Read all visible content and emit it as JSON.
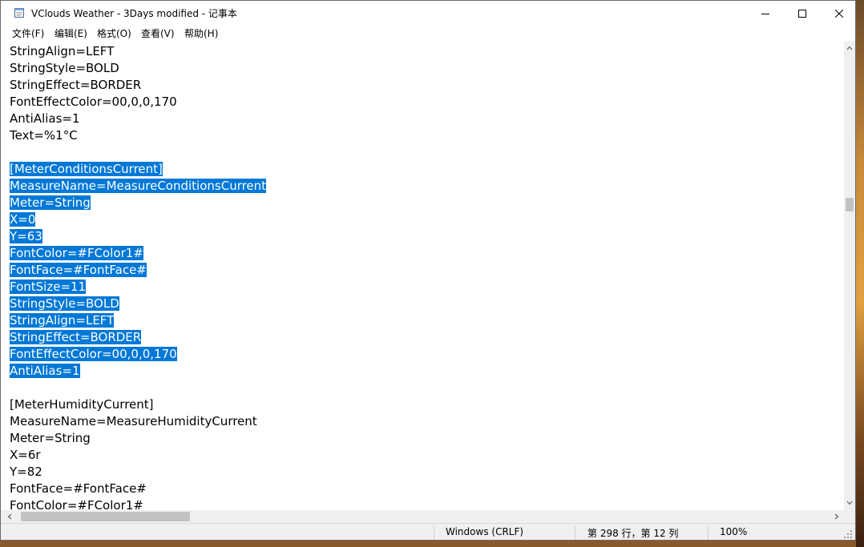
{
  "window": {
    "title": "VClouds Weather - 3Days modified - 记事本",
    "controls": {
      "minimize": "—",
      "maximize": "☐",
      "close": "✕"
    }
  },
  "menu": [
    "文件(F)",
    "编辑(E)",
    "格式(O)",
    "查看(V)",
    "帮助(H)"
  ],
  "editor": {
    "lines": [
      "StringAlign=LEFT",
      "StringStyle=BOLD",
      "StringEffect=BORDER",
      "FontEffectColor=00,0,0,170",
      "AntiAlias=1",
      "Text=%1°C",
      "",
      "[MeterConditionsCurrent]",
      "MeasureName=MeasureConditionsCurrent",
      "Meter=String",
      "X=0",
      "Y=63",
      "FontColor=#FColor1#",
      "FontFace=#FontFace#",
      "FontSize=11",
      "StringStyle=BOLD",
      "StringAlign=LEFT",
      "StringEffect=BORDER",
      "FontEffectColor=00,0,0,170",
      "AntiAlias=1",
      "",
      "[MeterHumidityCurrent]",
      "MeasureName=MeasureHumidityCurrent",
      "Meter=String",
      "X=6r",
      "Y=82",
      "FontFace=#FontFace#",
      "FontColor=#FColor1#"
    ],
    "selection": {
      "first_line": 7,
      "last_line": 19
    },
    "colors": {
      "selection_bg": "#0078d7",
      "selection_fg": "#ffffff"
    }
  },
  "statusbar": {
    "encoding": "Windows (CRLF)",
    "position": "第 298 行，第 12 列",
    "zoom": "100%"
  }
}
